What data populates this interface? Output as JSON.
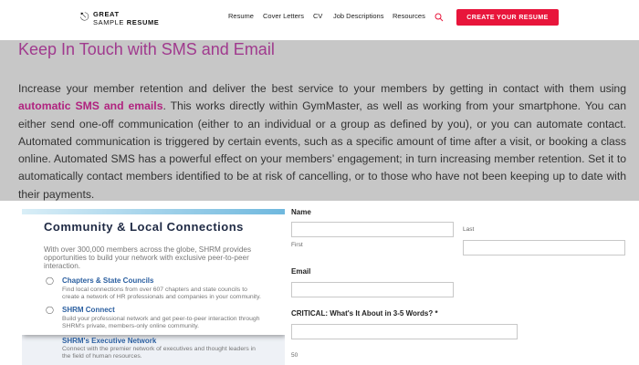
{
  "brand": {
    "logo_top": "GREAT",
    "logo_bottom_a": "SAMPLE ",
    "logo_bottom_b": "RESUME"
  },
  "nav": {
    "items": [
      "Resume",
      "Cover Letters",
      "CV",
      "Job Descriptions",
      "Resources"
    ]
  },
  "cta": {
    "label": "CREATE YOUR RESUME"
  },
  "article": {
    "headline": "Keep In Touch with SMS and Email",
    "para_before": "Increase your member retention and deliver the best service to your members by getting in contact with them using ",
    "para_link": "automatic SMS and emails",
    "para_after": ". This works directly within GymMaster, as well as working from your smartphone. You can either send one-off communication (either to an individual or a group as defined by you), or you can automate contact. Automated communication is triggered by certain events, such as a specific amount of time after a visit, or booking a class online. Automated SMS has a powerful effect on your members’ engagement; in turn increasing member retention. Set it to automatically contact members identified to be at risk of cancelling, or to those who have not been keeping up to date with their payments."
  },
  "card": {
    "title": "Community & Local Connections",
    "body": "With over 300,000 members across the globe, SHRM provides opportunities to build your network with exclusive peer-to-peer interaction.",
    "subs": [
      {
        "title": "Chapters & State Councils",
        "text": "Find local connections from over 607 chapters and state councils to create a network of HR professionals and companies in your community."
      },
      {
        "title": "SHRM Connect",
        "text": "Build your professional network and get peer-to-peer interaction through SHRM's private, members-only online community."
      },
      {
        "title": "SHRM's Executive Network",
        "text": "Connect with the premier network of executives and thought leaders in the field of human resources."
      }
    ]
  },
  "form": {
    "name_label": "Name",
    "first_label": "First",
    "last_label": "Last",
    "email_label": "Email",
    "critical_label": "CRITICAL: What's It About in 3-5 Words? *",
    "counter": "50"
  }
}
